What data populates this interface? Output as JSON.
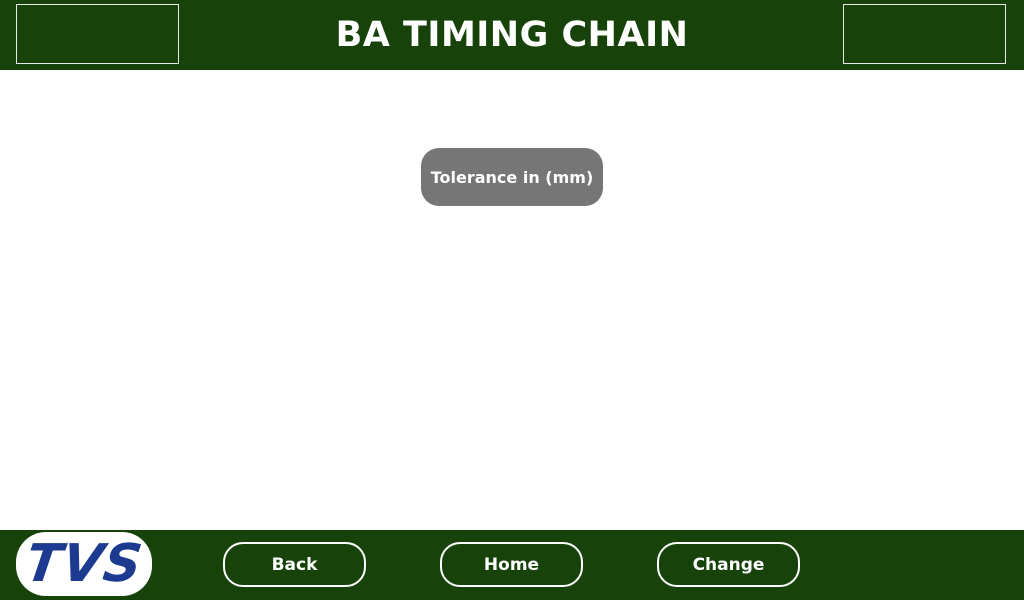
{
  "header": {
    "title": "BA TIMING CHAIN"
  },
  "main": {
    "tolerance_label": "Tolerance in (mm)"
  },
  "footer": {
    "logo_text": "TVS",
    "buttons": {
      "back": "Back",
      "home": "Home",
      "change": "Change"
    }
  },
  "colors": {
    "bar_green": "#17430a",
    "pill_gray": "#767676",
    "logo_blue": "#1c3a8f"
  }
}
